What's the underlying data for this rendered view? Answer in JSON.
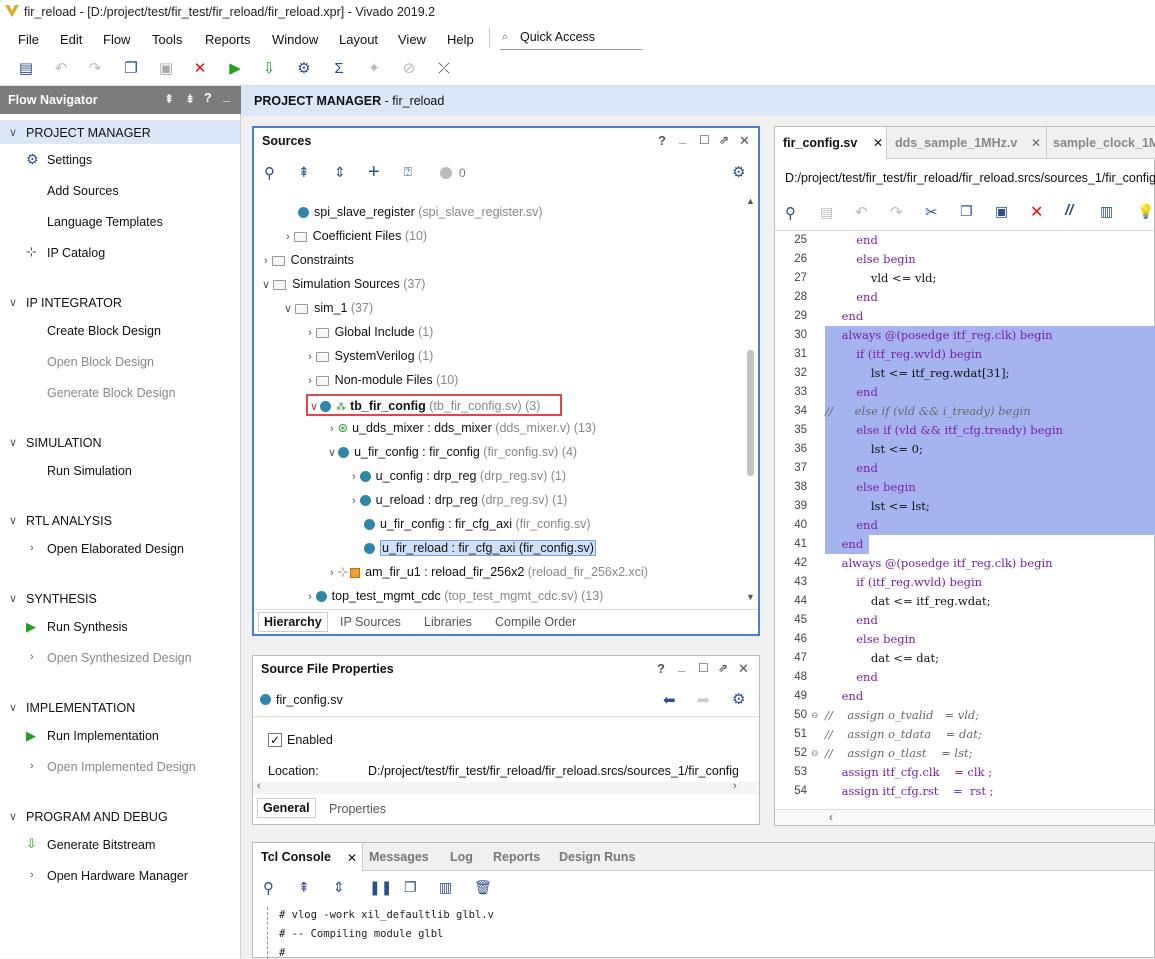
{
  "window": {
    "title": "fir_reload - [D:/project/test/fir_test/fir_reload/fir_reload.xpr] - Vivado 2019.2"
  },
  "menu": [
    "File",
    "Edit",
    "Flow",
    "Tools",
    "Reports",
    "Window",
    "Layout",
    "View",
    "Help"
  ],
  "quick_access": {
    "placeholder": "Quick Access"
  },
  "flow_nav": {
    "title": "Flow Navigator",
    "sections": [
      {
        "label": "PROJECT MANAGER",
        "items": [
          "Settings",
          "Add Sources",
          "Language Templates",
          "IP Catalog"
        ]
      },
      {
        "label": "IP INTEGRATOR",
        "items": [
          "Create Block Design",
          "Open Block Design",
          "Generate Block Design"
        ]
      },
      {
        "label": "SIMULATION",
        "items": [
          "Run Simulation"
        ]
      },
      {
        "label": "RTL ANALYSIS",
        "items": [
          "Open Elaborated Design"
        ]
      },
      {
        "label": "SYNTHESIS",
        "items": [
          "Run Synthesis",
          "Open Synthesized Design"
        ]
      },
      {
        "label": "IMPLEMENTATION",
        "items": [
          "Run Implementation",
          "Open Implemented Design"
        ]
      },
      {
        "label": "PROGRAM AND DEBUG",
        "items": [
          "Generate Bitstream",
          "Open Hardware Manager"
        ]
      }
    ]
  },
  "pm_header": {
    "prefix": "PROJECT MANAGER",
    "suffix": " - fir_reload"
  },
  "sources": {
    "title": "Sources",
    "count": "0",
    "tree": [
      {
        "name": "spi_slave_register",
        "detail": " (spi_slave_register.sv)"
      },
      {
        "name": "Coefficient Files",
        "detail": " (10)"
      },
      {
        "name": "Constraints",
        "detail": ""
      },
      {
        "name": "Simulation Sources",
        "detail": " (37)"
      },
      {
        "name": "sim_1",
        "detail": " (37)"
      },
      {
        "name": "Global Include",
        "detail": " (1)"
      },
      {
        "name": "SystemVerilog",
        "detail": " (1)"
      },
      {
        "name": "Non-module Files",
        "detail": " (10)"
      },
      {
        "name": "tb_fir_config",
        "detail": " (tb_fir_config.sv) (3)"
      },
      {
        "name": "u_dds_mixer : dds_mixer",
        "detail": " (dds_mixer.v) (13)"
      },
      {
        "name": "u_fir_config : fir_config",
        "detail": " (fir_config.sv) (4)"
      },
      {
        "name": "u_config : drp_reg",
        "detail": " (drp_reg.sv) (1)"
      },
      {
        "name": "u_reload : drp_reg",
        "detail": " (drp_reg.sv) (1)"
      },
      {
        "name": "u_fir_config : fir_cfg_axi",
        "detail": " (fir_config.sv)"
      },
      {
        "name": "u_fir_reload : fir_cfg_axi",
        "detail": " (fir_config.sv)"
      },
      {
        "name": "am_fir_u1 : reload_fir_256x2",
        "detail": " (reload_fir_256x2.xci)"
      },
      {
        "name": "top_test_mgmt_cdc",
        "detail": " (top_test_mgmt_cdc.sv) (13)"
      }
    ],
    "tabs": [
      "Hierarchy",
      "IP Sources",
      "Libraries",
      "Compile Order"
    ]
  },
  "sfp": {
    "title": "Source File Properties",
    "file": "fir_config.sv",
    "enabled_label": "Enabled",
    "location_label": "Location:",
    "location_value": "D:/project/test/fir_test/fir_reload/fir_reload.srcs/sources_1/fir_config",
    "tabs": [
      "General",
      "Properties"
    ]
  },
  "editor": {
    "tabs": [
      "fir_config.sv",
      "dds_sample_1MHz.v",
      "sample_clock_1M"
    ],
    "path": "D:/project/test/fir_test/fir_reload/fir_reload.srcs/sources_1/fir_config/",
    "lines": [
      {
        "n": "25",
        "t": "        end"
      },
      {
        "n": "26",
        "t": "        else begin"
      },
      {
        "n": "27",
        "t": "            vld <= vld;"
      },
      {
        "n": "28",
        "t": "        end"
      },
      {
        "n": "29",
        "t": "    end"
      },
      {
        "n": "30",
        "t": "    always @(posedge itf_reg.clk) begin"
      },
      {
        "n": "31",
        "t": "        if (itf_reg.wvld) begin"
      },
      {
        "n": "32",
        "t": "            lst <= itf_reg.wdat[31];"
      },
      {
        "n": "33",
        "t": "        end"
      },
      {
        "n": "34",
        "t": "//      else if (vld && i_tready) begin"
      },
      {
        "n": "35",
        "t": "        else if (vld && itf_cfg.tready) begin"
      },
      {
        "n": "36",
        "t": "            lst <= 0;"
      },
      {
        "n": "37",
        "t": "        end"
      },
      {
        "n": "38",
        "t": "        else begin"
      },
      {
        "n": "39",
        "t": "            lst <= lst;"
      },
      {
        "n": "40",
        "t": "        end"
      },
      {
        "n": "41",
        "t": "    end"
      },
      {
        "n": "42",
        "t": "    always @(posedge itf_reg.clk) begin"
      },
      {
        "n": "43",
        "t": "        if (itf_reg.wvld) begin"
      },
      {
        "n": "44",
        "t": "            dat <= itf_reg.wdat;"
      },
      {
        "n": "45",
        "t": "        end"
      },
      {
        "n": "46",
        "t": "        else begin"
      },
      {
        "n": "47",
        "t": "            dat <= dat;"
      },
      {
        "n": "48",
        "t": "        end"
      },
      {
        "n": "49",
        "t": "    end"
      },
      {
        "n": "50",
        "t": "//    assign o_tvalid   = vld;"
      },
      {
        "n": "51",
        "t": "//    assign o_tdata    = dat;"
      },
      {
        "n": "52",
        "t": "//    assign o_tlast    = lst;"
      },
      {
        "n": "53",
        "t": "    assign itf_cfg.clk    = clk ;"
      },
      {
        "n": "54",
        "t": "    assign itf_cfg.rst    =  rst ;"
      }
    ]
  },
  "console": {
    "tabs": [
      "Tcl Console",
      "Messages",
      "Log",
      "Reports",
      "Design Runs"
    ],
    "lines": [
      "# vlog -work xil_defaultlib glbl.v",
      "# -- Compiling module glbl",
      "#"
    ]
  }
}
